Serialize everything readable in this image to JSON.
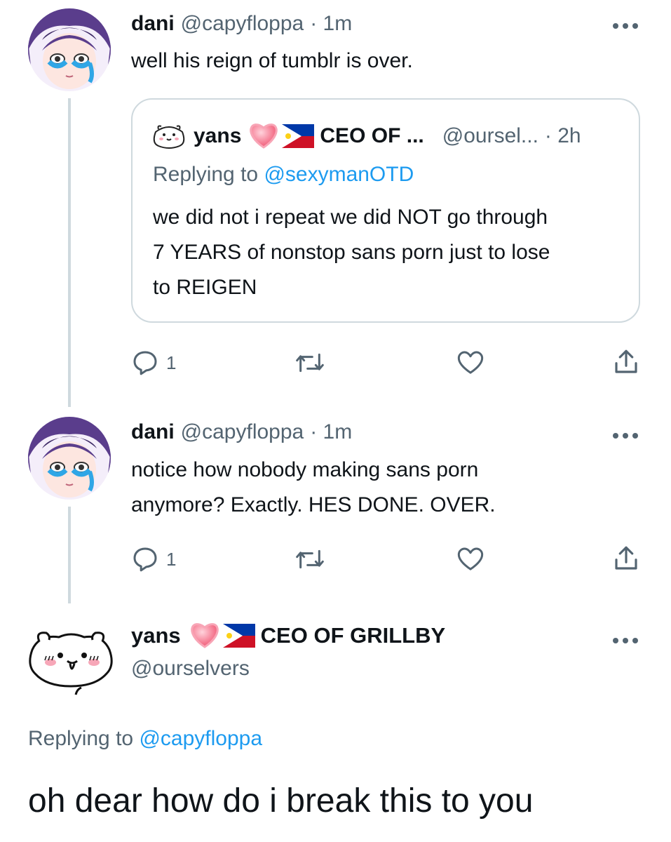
{
  "tweet1": {
    "name": "dani",
    "handle": "@capyfloppa",
    "time": "· 1m",
    "text": "well his reign of tumblr is over.",
    "quote": {
      "name": "yans",
      "display_suffix": "CEO OF ...",
      "handle": "@oursel...",
      "time": "· 2h",
      "replying_prefix": "Replying to ",
      "replying_handle": "@sexymanOTD",
      "text_lines": [
        "we did not i repeat we did NOT go through",
        "7 YEARS of nonstop sans porn just to lose",
        "to REIGEN"
      ]
    },
    "actions": {
      "reply_count": "1"
    }
  },
  "tweet2": {
    "name": "dani",
    "handle": "@capyfloppa",
    "time": "· 1m",
    "text_lines": [
      "notice how nobody making sans porn",
      "anymore? Exactly. HES DONE. OVER."
    ],
    "actions": {
      "reply_count": "1"
    }
  },
  "main_tweet": {
    "name": "yans",
    "display_suffix": "CEO OF GRILLBY",
    "handle": "@ourselvers",
    "replying_prefix": "Replying to ",
    "replying_handle": "@capyfloppa",
    "text": "oh dear how do i break this to you"
  },
  "icons": {
    "more": "more-dots-icon",
    "reply": "reply-icon",
    "retweet": "retweet-icon",
    "like": "heart-icon",
    "share": "share-icon",
    "heart_emoji": "heart-emoji-icon",
    "flag": "philippines-flag-icon"
  },
  "colors": {
    "text": "#0f1419",
    "secondary": "#536471",
    "link": "#1d9bf0",
    "border": "#cfd9de"
  }
}
